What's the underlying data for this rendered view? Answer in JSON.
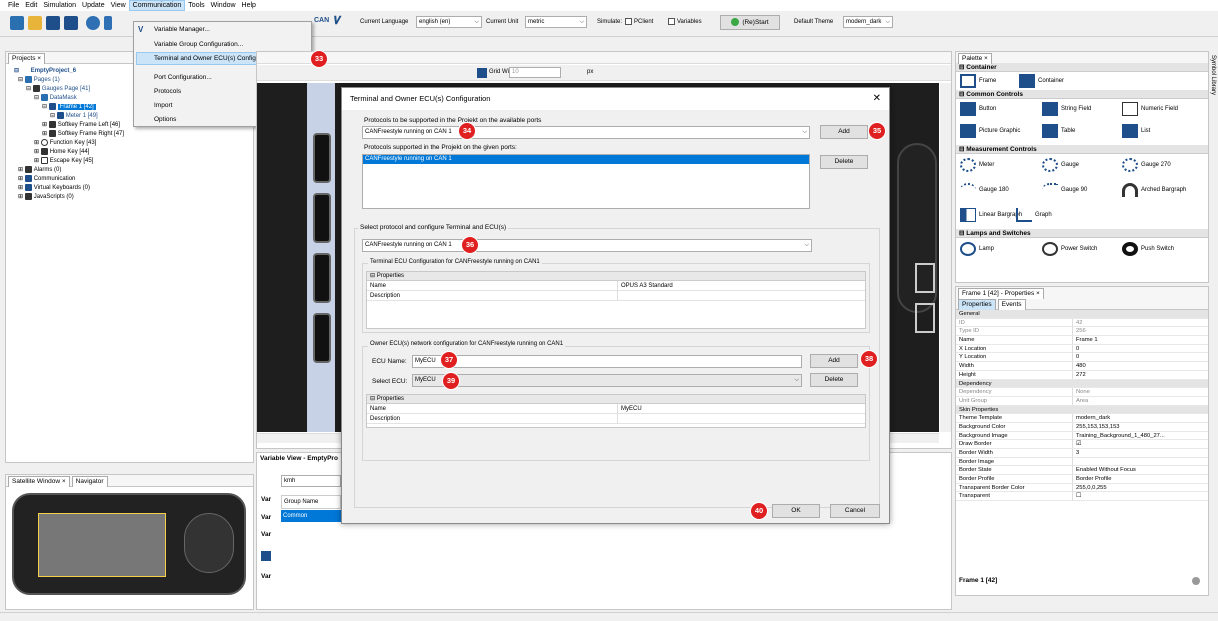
{
  "menubar": {
    "items": [
      "File",
      "Edit",
      "Simulation",
      "Update",
      "View",
      "Communication",
      "Tools",
      "Window",
      "Help"
    ]
  },
  "toolbar": {
    "current_language_label": "Current Language",
    "current_language": "english (en)",
    "current_unit_label": "Current Unit",
    "current_unit": "metric",
    "simulate_label": "Simulate:",
    "pclient": "PClient",
    "variables": "Variables",
    "restart": "(Re)Start",
    "default_theme_label": "Default Theme",
    "default_theme": "modern_dark",
    "can_label": "CAN",
    "grid_width_label": "Grid Width:",
    "grid_width": "10",
    "px": "px"
  },
  "comm_menu": {
    "items": [
      "Variable Manager...",
      "Variable Group Configuration...",
      "Terminal and Owner ECU(s) Configuration...",
      "Port Configuration...",
      "Protocols",
      "Import",
      "Options"
    ]
  },
  "projects": {
    "tab": "Projects",
    "tree": [
      "EmptyProject_6",
      "Pages (1)",
      "Gauges Page [41]",
      "DataMask",
      "Frame 1 [42]",
      "Meter 1 [49]",
      "Softkey Frame Left [46]",
      "Softkey Frame Right [47]",
      "Function Key [43]",
      "Home Key [44]",
      "Escape Key [45]",
      "Alarms (0)",
      "Communication",
      "Virtual Keyboards (0)",
      "JavaScripts (0)"
    ]
  },
  "satellite": {
    "tab1": "Satellite Window",
    "tab2": "Navigator"
  },
  "variable_view": {
    "title": "Variable View - EmptyPro",
    "search": "kmh",
    "col_group": "Group Name",
    "row_common": "Common",
    "var": "Var"
  },
  "dialog": {
    "title": "Terminal and Owner ECU(s) Configuration",
    "protocols_label": "Protocols to be supported in the Projekt on the available ports",
    "protocol_select": "CANFreestyle running on CAN 1",
    "add": "Add",
    "supported_label": "Protocols supported in the Projekt on the given ports:",
    "supported_item": "CANFreestyle running on CAN 1",
    "delete": "Delete",
    "select_label": "Select protocol and configure Terminal and ECU(s)",
    "select_protocol": "CANFreestyle running on CAN 1",
    "terminal_cfg_label": "Terminal ECU Configuration for CANFreestyle running on CAN1",
    "properties": "Properties",
    "name": "Name",
    "description": "Description",
    "terminal_name_value": "OPUS A3 Standard",
    "owner_cfg_label": "Owner ECU(s) network configuration  for CANFreestyle running on CAN1",
    "ecu_name_label": "ECU Name:",
    "ecu_name_value": "MyECU",
    "select_ecu_label": "Select ECU:",
    "select_ecu_value": "MyECU",
    "owner_name_value": "MyECU",
    "ok": "OK",
    "cancel": "Cancel"
  },
  "badges": [
    "33",
    "34",
    "35",
    "36",
    "37",
    "38",
    "39",
    "40"
  ],
  "palette": {
    "tab": "Palette",
    "sections": [
      "Container",
      "Common Controls",
      "Measurement Controls",
      "Lamps and Switches"
    ],
    "container": [
      "Frame",
      "Container"
    ],
    "common": [
      "Button",
      "String Field",
      "Numeric Field",
      "Picture Graphic",
      "Table",
      "List"
    ],
    "measurement": [
      "Meter",
      "Gauge",
      "Gauge 270",
      "Gauge 180",
      "Gauge 90",
      "Arched Bargraph",
      "Linear Bargraph",
      "Graph"
    ],
    "lamps": [
      "Lamp",
      "Power Switch",
      "Push Switch"
    ],
    "symbol_library": "Symbol Library"
  },
  "properties": {
    "title": "Frame 1 [42] - Properties",
    "tab_properties": "Properties",
    "tab_events": "Events",
    "rows": [
      {
        "k": "General",
        "v": "",
        "h": true
      },
      {
        "k": "ID",
        "v": "42",
        "g": true
      },
      {
        "k": "Type ID",
        "v": "256",
        "g": true
      },
      {
        "k": "Name",
        "v": "Frame 1"
      },
      {
        "k": "X Location",
        "v": "0"
      },
      {
        "k": "Y Location",
        "v": "0"
      },
      {
        "k": "Width",
        "v": "480"
      },
      {
        "k": "Height",
        "v": "272"
      },
      {
        "k": "Dependency",
        "v": "",
        "h": true
      },
      {
        "k": "Dependency",
        "v": "None",
        "g": true
      },
      {
        "k": "Unit Group",
        "v": "Area",
        "g": true
      },
      {
        "k": "Skin Properties",
        "v": "",
        "h": true
      },
      {
        "k": "Theme Template",
        "v": "modern_dark"
      },
      {
        "k": "Background Color",
        "v": "255,153,153,153"
      },
      {
        "k": "Background Image",
        "v": "Training_Background_1_480_27..."
      },
      {
        "k": "Draw Border",
        "v": "☑"
      },
      {
        "k": "Border Width",
        "v": "3"
      },
      {
        "k": "Border Image",
        "v": ""
      },
      {
        "k": "Border State",
        "v": "Enabled Without Focus"
      },
      {
        "k": "Border Profile",
        "v": "Border Profile"
      },
      {
        "k": "Transparent Border Color",
        "v": "255,0,0,255"
      },
      {
        "k": "Transparent",
        "v": "☐"
      }
    ],
    "footer": "Frame 1 [42]"
  }
}
